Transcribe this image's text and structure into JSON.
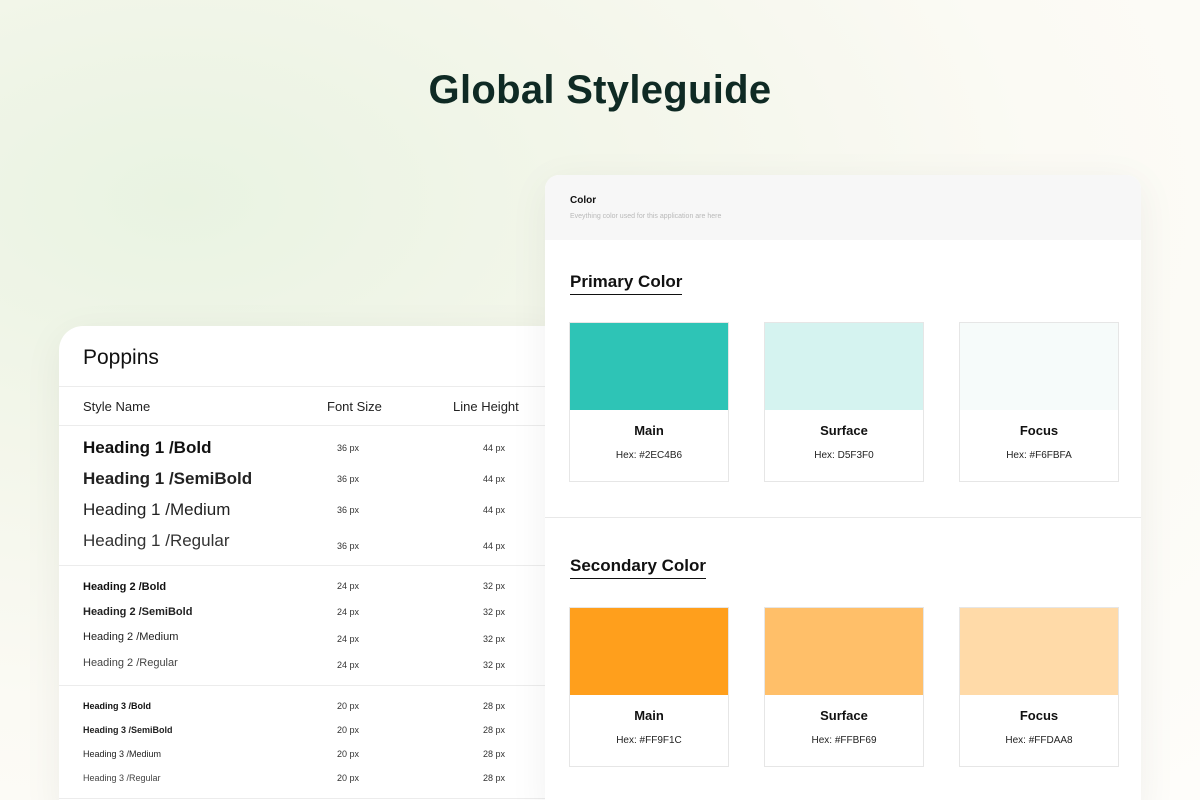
{
  "page_title": "Global Styleguide",
  "typography": {
    "font_name": "Poppins",
    "columns": {
      "style_name": "Style Name",
      "font_size": "Font Size",
      "line_height": "Line Height"
    },
    "groups": [
      {
        "rows": [
          {
            "name": "Heading 1 /Bold",
            "size": "36 px",
            "line_height": "44 px"
          },
          {
            "name": "Heading 1 /SemiBold",
            "size": "36 px",
            "line_height": "44 px"
          },
          {
            "name": "Heading 1 /Medium",
            "size": "36 px",
            "line_height": "44 px"
          },
          {
            "name": "Heading 1 /Regular",
            "size": "36 px",
            "line_height": "44 px"
          }
        ]
      },
      {
        "rows": [
          {
            "name": "Heading 2 /Bold",
            "size": "24 px",
            "line_height": "32 px"
          },
          {
            "name": "Heading 2 /SemiBold",
            "size": "24 px",
            "line_height": "32 px"
          },
          {
            "name": "Heading 2 /Medium",
            "size": "24 px",
            "line_height": "32 px"
          },
          {
            "name": "Heading 2 /Regular",
            "size": "24 px",
            "line_height": "32 px"
          }
        ]
      },
      {
        "rows": [
          {
            "name": "Heading 3 /Bold",
            "size": "20 px",
            "line_height": "28 px"
          },
          {
            "name": "Heading 3 /SemiBold",
            "size": "20 px",
            "line_height": "28 px"
          },
          {
            "name": "Heading 3 /Medium",
            "size": "20 px",
            "line_height": "28 px"
          },
          {
            "name": "Heading 3 /Regular",
            "size": "20 px",
            "line_height": "28 px"
          }
        ]
      }
    ]
  },
  "color": {
    "title": "Color",
    "subtitle": "Eveything color used for this application are here",
    "primary": {
      "title": "Primary Color",
      "swatches": [
        {
          "name": "Main",
          "hex_label": "Hex: #2EC4B6",
          "color": "#2EC4B6"
        },
        {
          "name": "Surface",
          "hex_label": "Hex: D5F3F0",
          "color": "#D5F3F0"
        },
        {
          "name": "Focus",
          "hex_label": "Hex: #F6FBFA",
          "color": "#F6FBFA"
        }
      ]
    },
    "secondary": {
      "title": "Secondary Color",
      "swatches": [
        {
          "name": "Main",
          "hex_label": "Hex: #FF9F1C",
          "color": "#FF9F1C"
        },
        {
          "name": "Surface",
          "hex_label": "Hex: #FFBF69",
          "color": "#FFBF69"
        },
        {
          "name": "Focus",
          "hex_label": "Hex: #FFDAA8",
          "color": "#FFDAA8"
        }
      ]
    }
  }
}
